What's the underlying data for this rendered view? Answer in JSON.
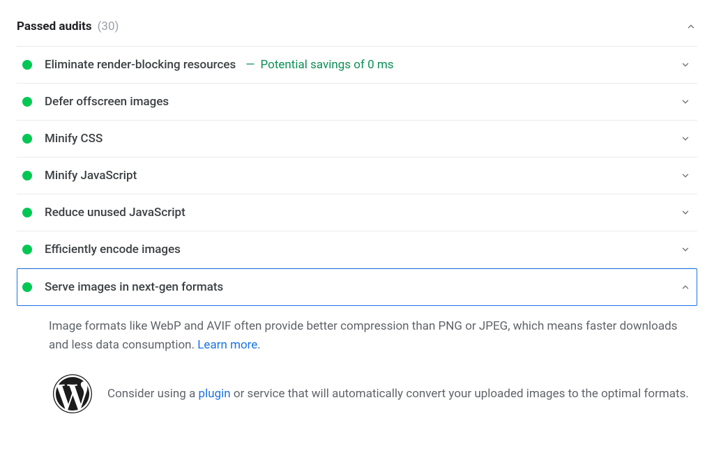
{
  "header": {
    "title": "Passed audits",
    "count": "(30)"
  },
  "audits": [
    {
      "label": "Eliminate render-blocking resources",
      "savings_sep": "—",
      "savings": "Potential savings of 0 ms",
      "expanded": false,
      "selected": false
    },
    {
      "label": "Defer offscreen images",
      "expanded": false,
      "selected": false
    },
    {
      "label": "Minify CSS",
      "expanded": false,
      "selected": false
    },
    {
      "label": "Minify JavaScript",
      "expanded": false,
      "selected": false
    },
    {
      "label": "Reduce unused JavaScript",
      "expanded": false,
      "selected": false
    },
    {
      "label": "Efficiently encode images",
      "expanded": false,
      "selected": false
    },
    {
      "label": "Serve images in next-gen formats",
      "expanded": true,
      "selected": true
    }
  ],
  "details": {
    "text_before_link": "Image formats like WebP and AVIF often provide better compression than PNG or JPEG, which means faster downloads and less data consumption. ",
    "learn_more": "Learn more",
    "text_after_link": "."
  },
  "tip": {
    "icon": "wordpress-icon",
    "text_before_link": "Consider using a ",
    "link": "plugin",
    "text_after_link": " or service that will automatically convert your uploaded images to the optimal formats."
  }
}
